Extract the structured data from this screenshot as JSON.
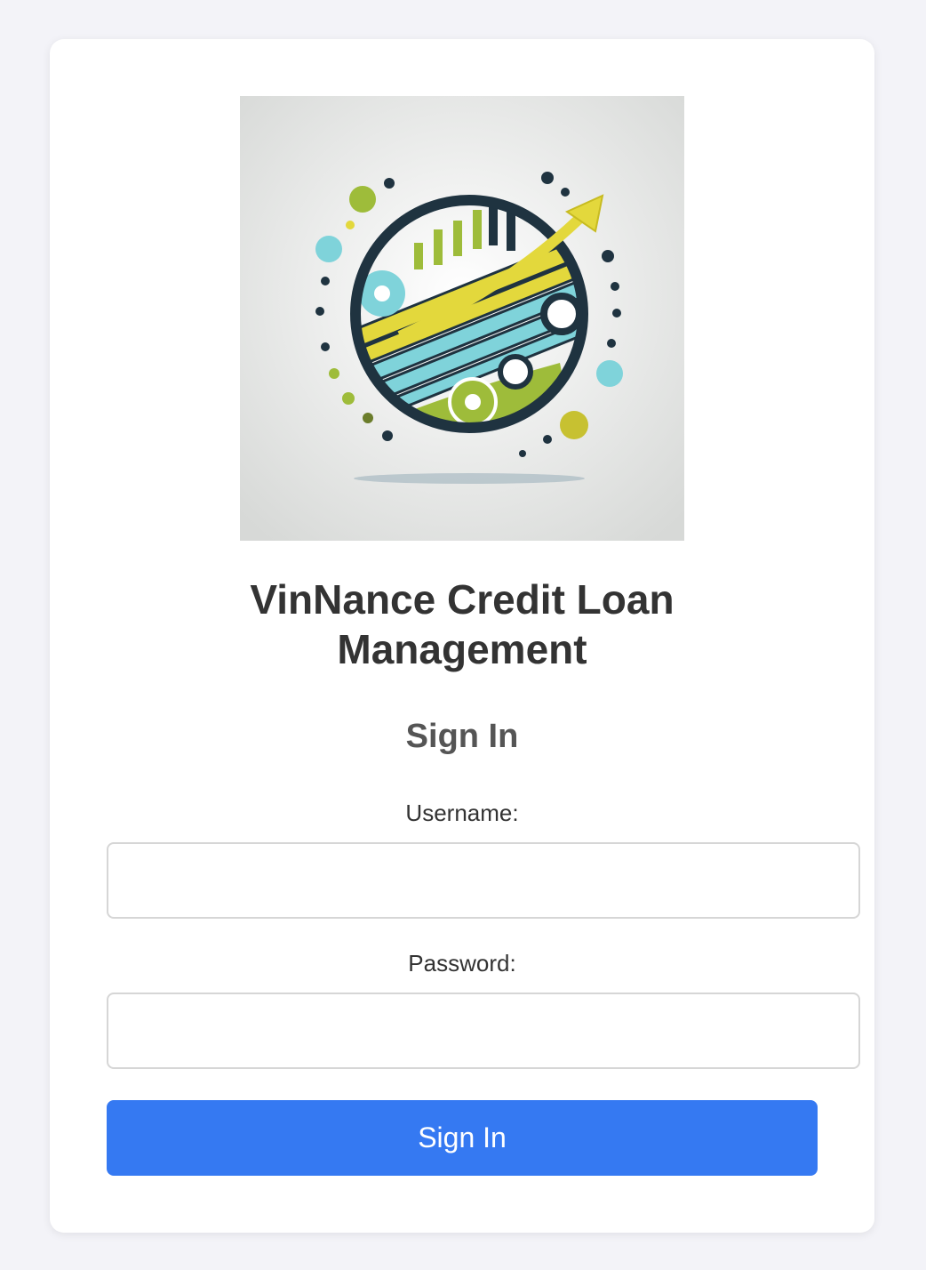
{
  "app": {
    "title_line1": "VinNance Credit Loan",
    "title_line2": "Management",
    "logo_icon": "credit-growth-logo-icon"
  },
  "form": {
    "heading": "Sign In",
    "username_label": "Username:",
    "username_value": "",
    "password_label": "Password:",
    "password_value": "",
    "submit_label": "Sign In"
  },
  "colors": {
    "page_background": "#f3f3f8",
    "card_background": "#ffffff",
    "button": "#3579f2",
    "logo_navy": "#1f3340",
    "logo_yellow": "#e3d83c",
    "logo_cyan": "#7fd3da",
    "logo_green": "#9ebc3a"
  }
}
